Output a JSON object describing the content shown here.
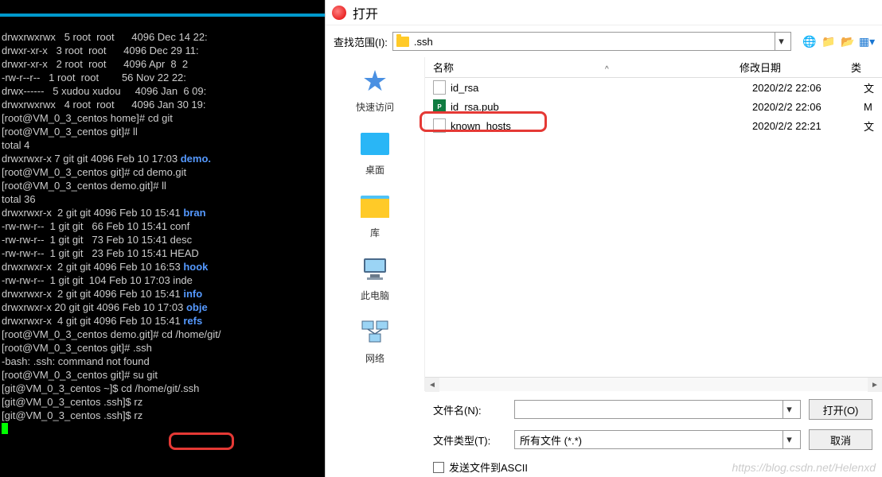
{
  "terminal": {
    "lines": [
      "drwxrwxrwx   5 root  root      4096 Dec 14 22:",
      "drwxr-xr-x   3 root  root      4096 Dec 29 11:",
      "drwxr-xr-x   2 root  root      4096 Apr  8  2",
      "-rw-r--r--   1 root  root        56 Nov 22 22:",
      "drwx------   5 xudou xudou     4096 Jan  6 09:",
      "drwxrwxrwx   4 root  root      4096 Jan 30 19:",
      "[root@VM_0_3_centos home]# cd git",
      "[root@VM_0_3_centos git]# ll",
      "total 4",
      "drwxrwxr-x 7 git git 4096 Feb 10 17:03 ",
      "[root@VM_0_3_centos git]# cd demo.git",
      "[root@VM_0_3_centos demo.git]# ll",
      "total 36",
      "drwxrwxr-x  2 git git 4096 Feb 10 15:41 ",
      "-rw-rw-r--  1 git git   66 Feb 10 15:41 conf",
      "-rw-rw-r--  1 git git   73 Feb 10 15:41 desc",
      "-rw-rw-r--  1 git git   23 Feb 10 15:41 HEAD",
      "drwxrwxr-x  2 git git 4096 Feb 10 16:53 ",
      "-rw-rw-r--  1 git git  104 Feb 10 17:03 inde",
      "drwxrwxr-x  2 git git 4096 Feb 10 15:41 ",
      "drwxrwxr-x 20 git git 4096 Feb 10 17:03 ",
      "drwxrwxr-x  4 git git 4096 Feb 10 15:41 ",
      "[root@VM_0_3_centos demo.git]# cd /home/git/",
      "[root@VM_0_3_centos git]# .ssh",
      "-bash: .ssh: command not found",
      "[root@VM_0_3_centos git]# su git",
      "[git@VM_0_3_centos ~]$ cd /home/git/.ssh",
      "[git@VM_0_3_centos .ssh]$ rz",
      "[git@VM_0_3_centos .ssh]$ rz"
    ],
    "blue_suffixes": {
      "9": "demo.",
      "13": "bran",
      "17": "hook",
      "19": "info",
      "20": "obje",
      "21": "refs"
    }
  },
  "dialog": {
    "title": "打开",
    "lookin_label": "查找范围(I):",
    "lookin_value": ".ssh",
    "sidebar": [
      {
        "label": "快速访问"
      },
      {
        "label": "桌面"
      },
      {
        "label": "库"
      },
      {
        "label": "此电脑"
      },
      {
        "label": "网络"
      }
    ],
    "columns": {
      "name": "名称",
      "date": "修改日期",
      "type": "类"
    },
    "files": [
      {
        "name": "id_rsa",
        "date": "2020/2/2 22:06",
        "type": "文",
        "icon": "doc"
      },
      {
        "name": "id_rsa.pub",
        "date": "2020/2/2 22:06",
        "type": "M",
        "icon": "pub"
      },
      {
        "name": "known_hosts",
        "date": "2020/2/2 22:21",
        "type": "文",
        "icon": "doc"
      }
    ],
    "filename_label": "文件名(N):",
    "filename_value": "",
    "filetype_label": "文件类型(T):",
    "filetype_value": "所有文件 (*.*)",
    "open_btn": "打开(O)",
    "cancel_btn": "取消",
    "ascii_checkbox": "发送文件到ASCII"
  },
  "watermark": "https://blog.csdn.net/Helenxd"
}
